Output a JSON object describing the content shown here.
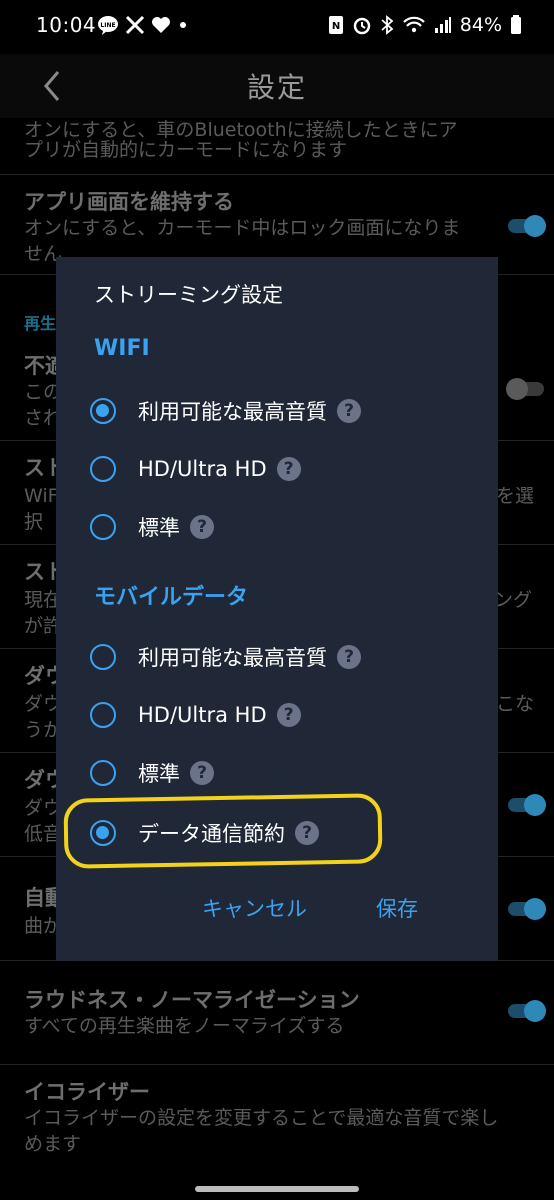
{
  "status": {
    "time": "10:04",
    "battery": "84%",
    "left_icons": [
      "line-icon",
      "x-icon",
      "heart-icon",
      "dot-icon"
    ],
    "right_icons": [
      "nfc-icon",
      "alarm-icon",
      "bluetooth-icon",
      "wifi-icon",
      "signal-icon",
      "battery-icon"
    ]
  },
  "appbar": {
    "title": "設定"
  },
  "background": {
    "row1": {
      "desc1": "オンにすると、車のBluetoothに接続したときにア",
      "desc2": "プリが自動的にカーモードになります"
    },
    "row2": {
      "title": "アプリ画面を維持する",
      "desc1": "オンにすると、カーモード中はロック画面になりま",
      "desc2": "せん"
    },
    "section_playback": "再生",
    "row3": {
      "title": "不適",
      "desc1": "この",
      "desc2": "され"
    },
    "row4": {
      "title": "スト",
      "desc1": "WiFi",
      "desc1_right": "を選",
      "desc2": "択"
    },
    "row5": {
      "title": "スト",
      "desc1": "現在",
      "desc1_right": "ング",
      "desc2": "が許"
    },
    "row6": {
      "title": "ダウ",
      "desc1": "ダウ",
      "desc1_right": "こな",
      "desc2": "うか"
    },
    "row7": {
      "title": "ダウ",
      "desc1": "ダウ",
      "desc2": "低音"
    },
    "row8": {
      "title": "自動",
      "desc1": "曲が"
    },
    "row9": {
      "title": "ラウドネス・ノーマライゼーション",
      "desc1": "すべての再生楽曲をノーマライズする"
    },
    "row10": {
      "title": "イコライザー",
      "desc1": "イコライザーの設定を変更することで最適な音質で楽し",
      "desc2": "めます"
    }
  },
  "dialog": {
    "title": "ストリーミング設定",
    "wifi": {
      "label": "WIFI",
      "options": [
        {
          "label": "利用可能な最高音質",
          "selected": true
        },
        {
          "label": "HD/Ultra HD",
          "selected": false
        },
        {
          "label": "標準",
          "selected": false
        }
      ]
    },
    "mobile": {
      "label": "モバイルデータ",
      "options": [
        {
          "label": "利用可能な最高音質",
          "selected": false
        },
        {
          "label": "HD/Ultra HD",
          "selected": false
        },
        {
          "label": "標準",
          "selected": false
        },
        {
          "label": "データ通信節約",
          "selected": true
        }
      ]
    },
    "help_glyph": "?",
    "cancel": "キャンセル",
    "save": "保存"
  },
  "colors": {
    "accent": "#3aa3f0",
    "dialog_bg": "#202736",
    "highlight": "#f2d21a"
  }
}
